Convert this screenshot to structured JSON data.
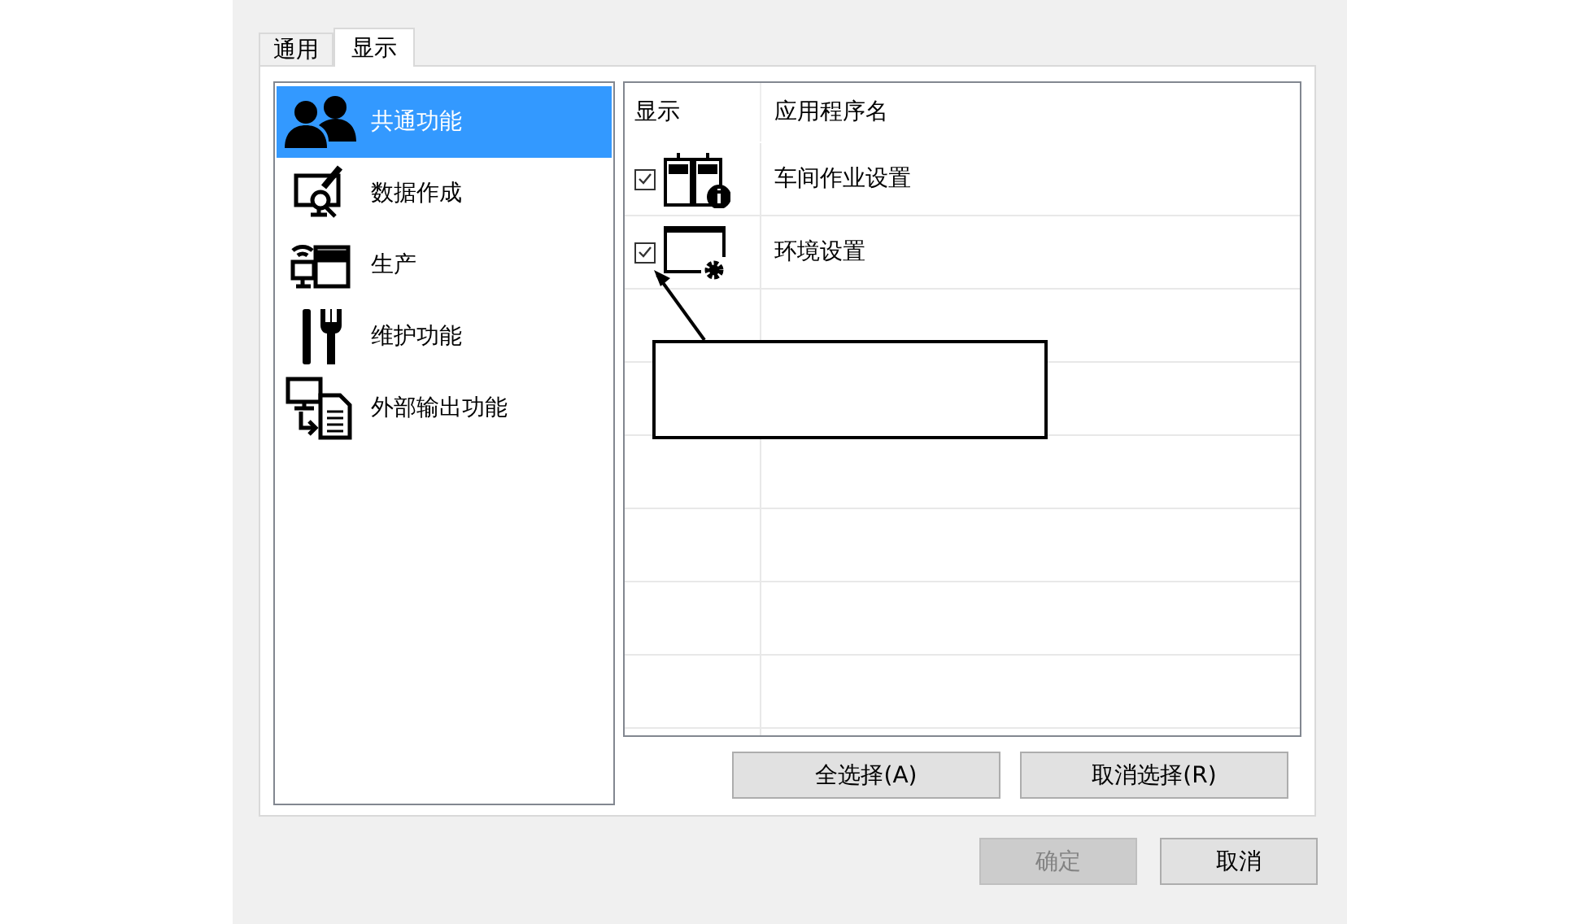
{
  "tabs": [
    {
      "label": "通用",
      "selected": false
    },
    {
      "label": "显示",
      "selected": true
    }
  ],
  "categories": [
    {
      "label": "共通功能",
      "selected": true
    },
    {
      "label": "数据作成",
      "selected": false
    },
    {
      "label": "生产",
      "selected": false
    },
    {
      "label": "维护功能",
      "selected": false
    },
    {
      "label": "外部输出功能",
      "selected": false
    }
  ],
  "table": {
    "columns": [
      "显示",
      "应用程序名"
    ],
    "rows": [
      {
        "checked": true,
        "name": "车间作业设置"
      },
      {
        "checked": true,
        "name": "环境设置"
      }
    ]
  },
  "select_buttons": [
    {
      "label": "全选择(A)"
    },
    {
      "label": "取消选择(R)"
    }
  ],
  "dialog_buttons": [
    {
      "label": "确定",
      "disabled": true
    },
    {
      "label": "取消",
      "disabled": false
    }
  ],
  "callout": {
    "kind": "empty-box"
  }
}
